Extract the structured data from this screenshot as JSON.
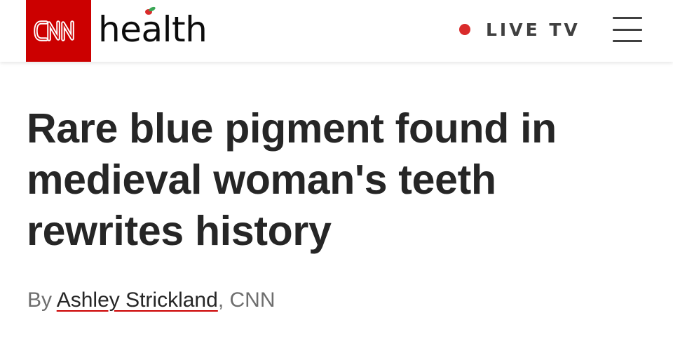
{
  "header": {
    "logo_text": "CNN",
    "section_name": "health",
    "live_label": "LIVE TV",
    "menu_icon": "hamburger-menu-icon",
    "live_icon": "live-dot-icon",
    "brand_color": "#cc0000",
    "live_dot_color": "#d92b2b"
  },
  "article": {
    "headline": "Rare blue pigment found in medieval woman's teeth rewrites history",
    "byline_prefix": "By ",
    "author": "Ashley Strickland",
    "byline_suffix": ", CNN"
  }
}
